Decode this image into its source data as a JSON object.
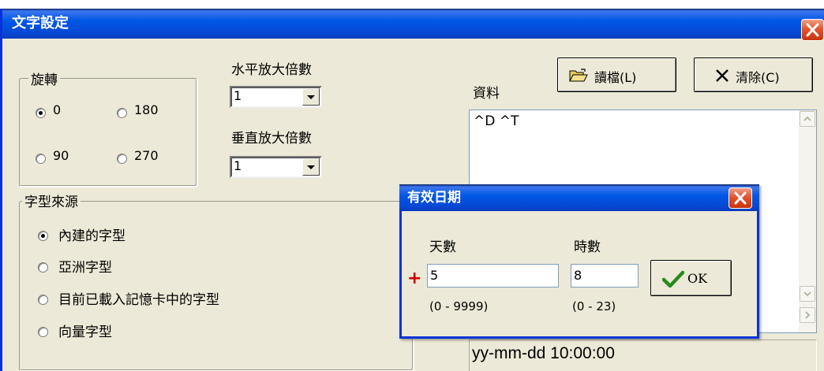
{
  "window": {
    "title": "文字設定"
  },
  "rotation": {
    "legend": "旋轉",
    "options": [
      {
        "label": "0",
        "selected": true
      },
      {
        "label": "180",
        "selected": false
      },
      {
        "label": "90",
        "selected": false
      },
      {
        "label": "270",
        "selected": false
      }
    ]
  },
  "scale": {
    "horizontal_label": "水平放大倍數",
    "horizontal_value": "1",
    "vertical_label": "垂直放大倍數",
    "vertical_value": "1"
  },
  "font_source": {
    "legend": "字型來源",
    "options": [
      {
        "label": "內建的字型",
        "selected": true
      },
      {
        "label": "亞洲字型",
        "selected": false
      },
      {
        "label": "目前已載入記憶卡中的字型",
        "selected": false
      },
      {
        "label": "向量字型",
        "selected": false
      }
    ]
  },
  "data_panel": {
    "label": "資料",
    "content": "^D ^T",
    "load_button": "讀檔(L)",
    "clear_button": "清除(C)",
    "preview": "yy-mm-dd 10:00:00"
  },
  "dialog": {
    "title": "有效日期",
    "days_label": "天數",
    "days_value": "5",
    "days_range": "(0 - 9999)",
    "hours_label": "時數",
    "hours_value": "8",
    "hours_range": "(0 - 23)",
    "required_marker": "+",
    "ok_button": "OK"
  },
  "colors": {
    "title_bar": "#0058e6",
    "window_bg": "#ece9d8",
    "close_button": "#e2542e",
    "ok_check": "#2a8a1a",
    "required_marker": "#d00000"
  },
  "icons": [
    "open-folder-icon",
    "x-icon",
    "close-icon",
    "checkmark-icon"
  ]
}
